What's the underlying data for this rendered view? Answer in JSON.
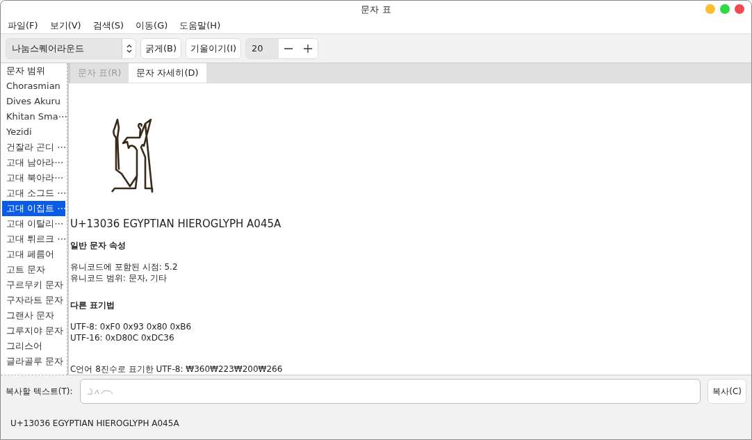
{
  "window": {
    "title": "문자 표",
    "controls": [
      {
        "color": "#fbbf2e"
      },
      {
        "color": "#30d843"
      },
      {
        "color": "#f24c52"
      }
    ]
  },
  "menu": [
    "파일(F)",
    "보기(V)",
    "검색(S)",
    "이동(G)",
    "도움말(H)"
  ],
  "toolbar": {
    "font": "나눔스퀘어라운드",
    "bold": "굵게(B)",
    "italic": "기울이기(I)",
    "size": "20"
  },
  "sidebar": {
    "header": "문자 범위",
    "items": [
      {
        "label": "Chorasmian",
        "selected": false
      },
      {
        "label": "Dives Akuru",
        "selected": false
      },
      {
        "label": "Khitan Sma⋯",
        "selected": false
      },
      {
        "label": "Yezidi",
        "selected": false
      },
      {
        "label": "건잘라 곤디 ⋯",
        "selected": false
      },
      {
        "label": "고대 남아라⋯",
        "selected": false
      },
      {
        "label": "고대 북아라⋯",
        "selected": false
      },
      {
        "label": "고대 소그드 ⋯",
        "selected": false
      },
      {
        "label": "고대 이집트 ⋯",
        "selected": true
      },
      {
        "label": "고대 이탈리⋯",
        "selected": false
      },
      {
        "label": "고대 튀르크 ⋯",
        "selected": false
      },
      {
        "label": "고대 페름어",
        "selected": false
      },
      {
        "label": "고트 문자",
        "selected": false
      },
      {
        "label": "구르무키 문자",
        "selected": false
      },
      {
        "label": "구자라트 문자",
        "selected": false
      },
      {
        "label": "그랜사 문자",
        "selected": false
      },
      {
        "label": "그루지야 문자",
        "selected": false
      },
      {
        "label": "그리스어",
        "selected": false
      },
      {
        "label": "글라골루 문자",
        "selected": false
      }
    ]
  },
  "tabs": [
    {
      "label": "문자 표(R)",
      "selected": false
    },
    {
      "label": "문자 자세히(D)",
      "selected": true
    }
  ],
  "details": {
    "title": "U+13036 EGYPTIAN HIEROGLYPH A045A",
    "sections": [
      {
        "heading": "일반 문자 속성",
        "lines": [
          "유니코드에 포함된 시점: 5.2",
          "유니코드 범위: 문자, 기타"
        ]
      },
      {
        "heading": "다른 표기법",
        "lines": [
          "UTF-8: 0xF0 0x93 0x80 0xB6",
          "UTF-16: 0xD80C 0xDC36"
        ]
      }
    ],
    "extra": "C언어 8진수로 표기한 UTF-8: ₩360₩223₩200₩266"
  },
  "copy": {
    "label": "복사할 텍스트(T):",
    "button": "복사(C)"
  },
  "status_bar": "U+13036 EGYPTIAN HIEROGLYPH A045A"
}
